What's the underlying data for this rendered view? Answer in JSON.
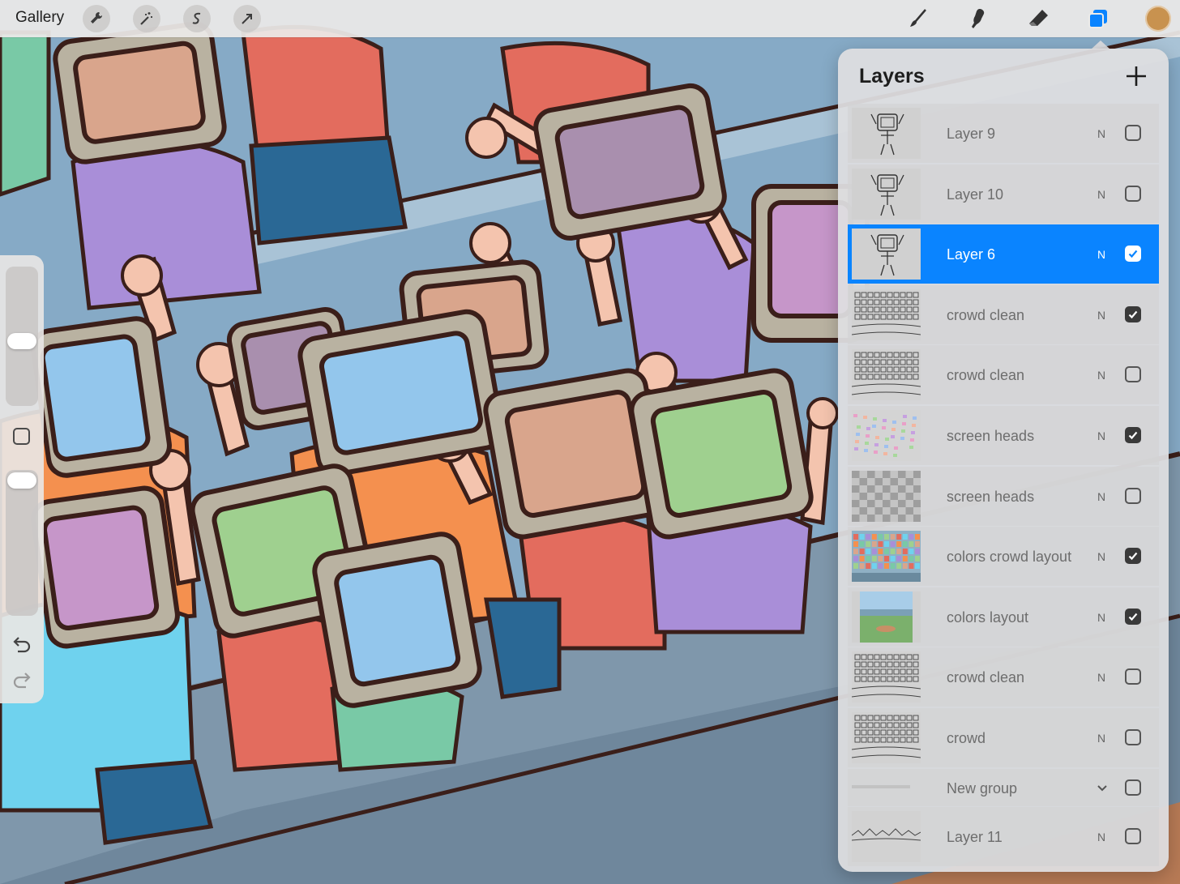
{
  "toolbar": {
    "gallery_label": "Gallery",
    "left_tools": [
      {
        "icon": "wrench-icon"
      },
      {
        "icon": "magic-wand-icon"
      },
      {
        "icon": "selection-icon"
      },
      {
        "icon": "transform-arrow-icon"
      }
    ],
    "right_tools": [
      {
        "icon": "brush-icon"
      },
      {
        "icon": "smudge-icon"
      },
      {
        "icon": "eraser-icon"
      },
      {
        "icon": "layers-icon",
        "active": true
      }
    ],
    "current_color": "#c8924f",
    "accent_color": "#0a84ff"
  },
  "sidebar": {
    "brush_size_level": 0.55,
    "opacity_level": 0.95,
    "controls": [
      "modify-button",
      "undo-icon",
      "redo-icon"
    ]
  },
  "layers_panel": {
    "title": "Layers",
    "layers": [
      {
        "name": "Layer 9",
        "blend": "N",
        "visible": false,
        "selected": false,
        "thumb": "sketch"
      },
      {
        "name": "Layer 10",
        "blend": "N",
        "visible": false,
        "selected": false,
        "thumb": "sketch"
      },
      {
        "name": "Layer 6",
        "blend": "N",
        "visible": true,
        "selected": true,
        "thumb": "sketch"
      },
      {
        "name": "crowd clean",
        "blend": "N",
        "visible": true,
        "selected": false,
        "thumb": "crowd"
      },
      {
        "name": "crowd clean",
        "blend": "N",
        "visible": false,
        "selected": false,
        "thumb": "crowd"
      },
      {
        "name": "screen heads",
        "blend": "N",
        "visible": true,
        "selected": false,
        "thumb": "dots"
      },
      {
        "name": "screen heads",
        "blend": "N",
        "visible": false,
        "selected": false,
        "thumb": "checker"
      },
      {
        "name": "colors crowd layout",
        "blend": "N",
        "visible": true,
        "selected": false,
        "thumb": "colorcrowd"
      },
      {
        "name": "colors layout",
        "blend": "N",
        "visible": true,
        "selected": false,
        "thumb": "field"
      },
      {
        "name": "crowd clean",
        "blend": "N",
        "visible": false,
        "selected": false,
        "thumb": "crowd"
      },
      {
        "name": "crowd",
        "blend": "N",
        "visible": false,
        "selected": false,
        "thumb": "crowd"
      },
      {
        "name": "New group",
        "blend": "",
        "visible": false,
        "selected": false,
        "thumb": "group",
        "is_group": true
      },
      {
        "name": "Layer 11",
        "blend": "N",
        "visible": false,
        "selected": false,
        "thumb": "strip"
      }
    ]
  }
}
